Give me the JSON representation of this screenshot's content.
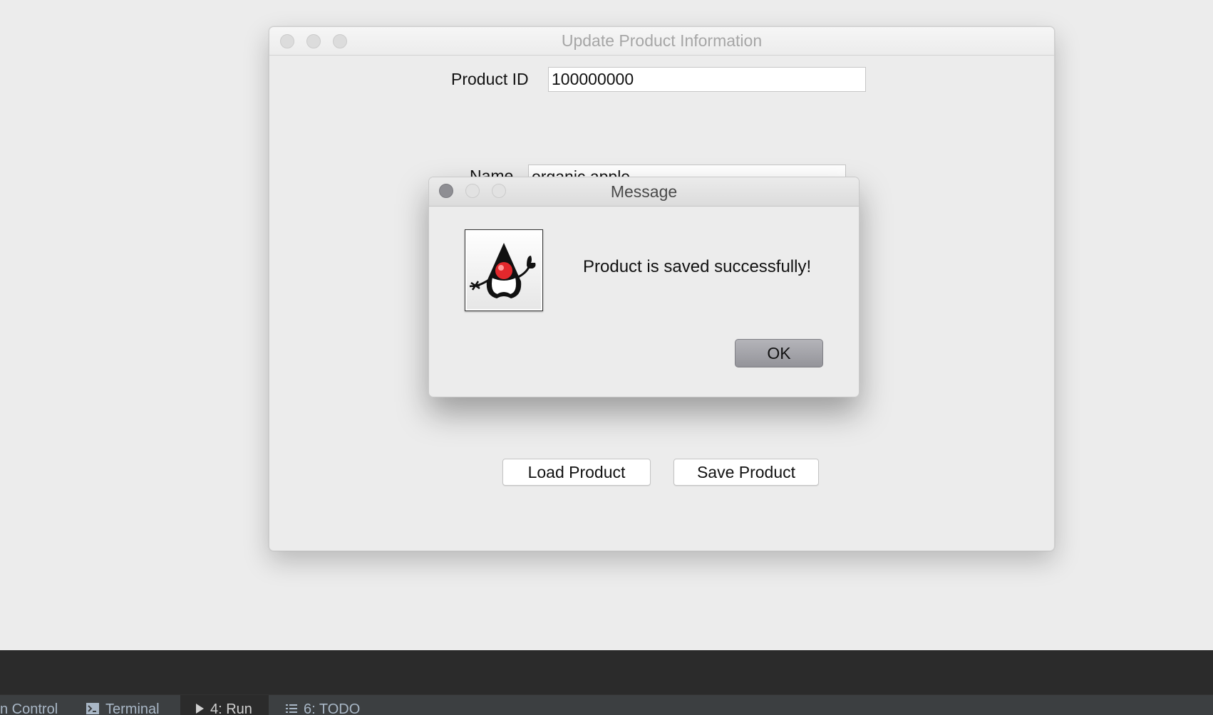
{
  "main_window": {
    "title": "Update Product Information",
    "product_id_label": "Product ID",
    "product_id_value": "100000000",
    "name_label": "Name",
    "name_value": "organic apple",
    "load_button": "Load Product",
    "save_button": "Save Product"
  },
  "dialog": {
    "title": "Message",
    "message": "Product is saved successfully!",
    "ok_button": "OK",
    "icon": "java-duke-icon"
  },
  "ide_tabs": [
    {
      "label": "n Control",
      "icon": "none"
    },
    {
      "label": "Terminal",
      "icon": "terminal-icon"
    },
    {
      "label": "4: Run",
      "icon": "run-icon",
      "active": true
    },
    {
      "label": "6: TODO",
      "icon": "todo-list-icon"
    }
  ]
}
